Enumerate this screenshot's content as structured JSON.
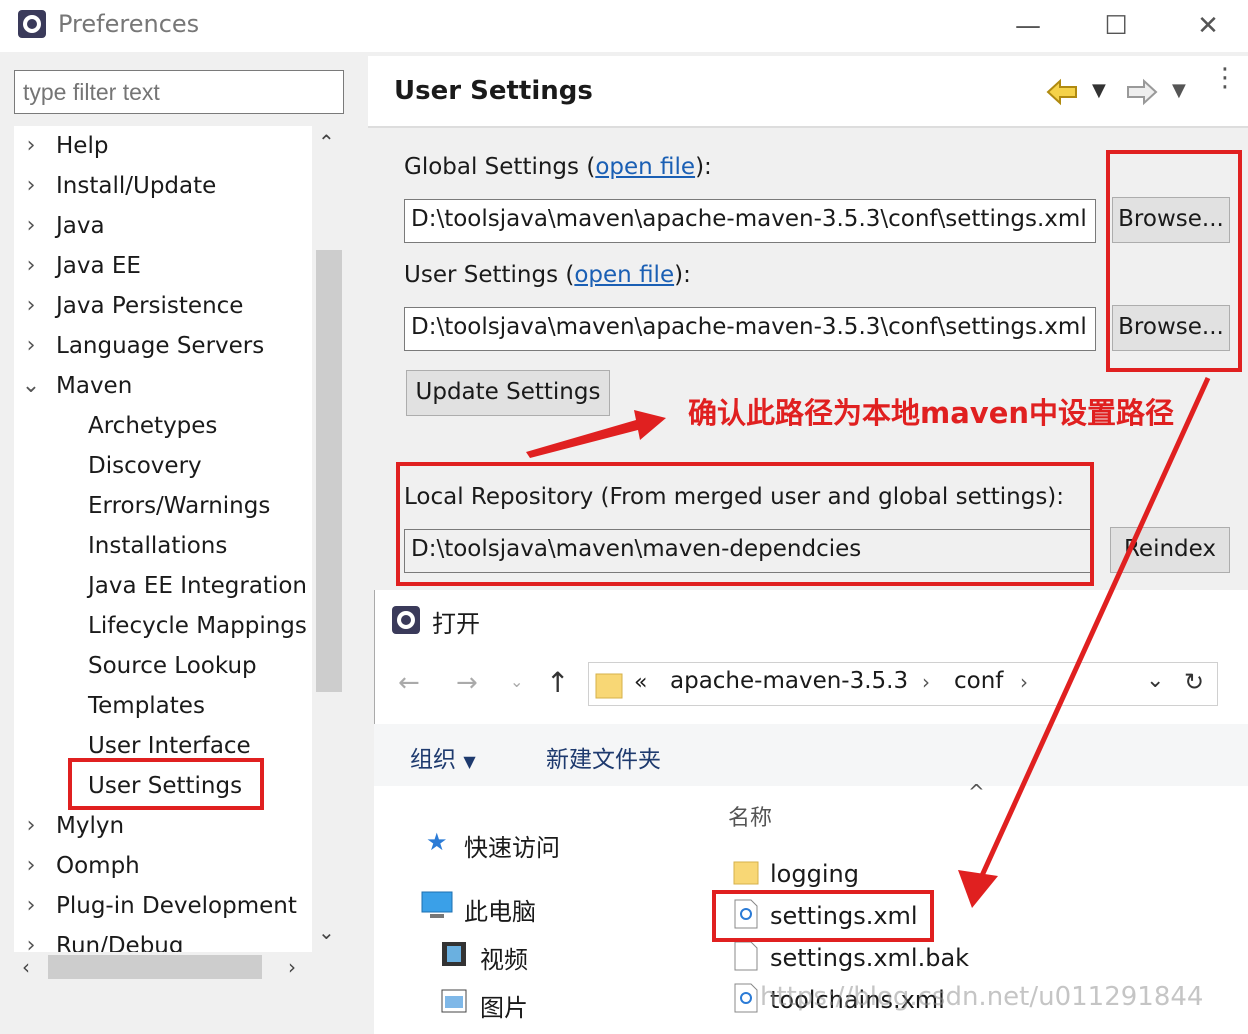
{
  "window": {
    "title": "Preferences"
  },
  "filter": {
    "placeholder": "type filter text"
  },
  "tree": {
    "top_items": [
      "Help",
      "Install/Update",
      "Java",
      "Java EE",
      "Java Persistence",
      "Language Servers",
      "Maven"
    ],
    "maven_children": [
      "Archetypes",
      "Discovery",
      "Errors/Warnings",
      "Installations",
      "Java EE Integration",
      "Lifecycle Mappings",
      "Source Lookup",
      "Templates",
      "User Interface",
      "User Settings"
    ],
    "after_items": [
      "Mylyn",
      "Oomph",
      "Plug-in Development",
      "Run/Debug"
    ],
    "selected": "User Settings"
  },
  "page": {
    "title": "User Settings",
    "global_label": "Global Settings (",
    "global_link": "open file",
    "global_label_end": "):",
    "global_value": "D:\\toolsjava\\maven\\apache-maven-3.5.3\\conf\\settings.xml",
    "user_label": "User Settings (",
    "user_link": "open file",
    "user_label_end": "):",
    "user_value": "D:\\toolsjava\\maven\\apache-maven-3.5.3\\conf\\settings.xml",
    "browse_label": "Browse...",
    "update_label": "Update Settings",
    "local_repo_label": "Local Repository (From merged user and global settings):",
    "local_repo_value": "D:\\toolsjava\\maven\\maven-dependcies",
    "reindex_label": "Reindex"
  },
  "annotation": {
    "text": "确认此路径为本地maven中设置路径",
    "color": "#e02020"
  },
  "dialog": {
    "title": "打开",
    "breadcrumb_prefix": "«",
    "breadcrumb": [
      "apache-maven-3.5.3",
      "conf"
    ],
    "toolbar": {
      "organize": "组织",
      "new_folder": "新建文件夹"
    },
    "nav": {
      "quick_access": "快速访问",
      "this_pc": "此电脑",
      "videos": "视频",
      "pictures": "图片"
    },
    "column_header": "名称",
    "files": [
      "logging",
      "settings.xml",
      "settings.xml.bak",
      "toolchains.xml"
    ]
  },
  "watermark": "https://blog.csdn.net/u011291844"
}
